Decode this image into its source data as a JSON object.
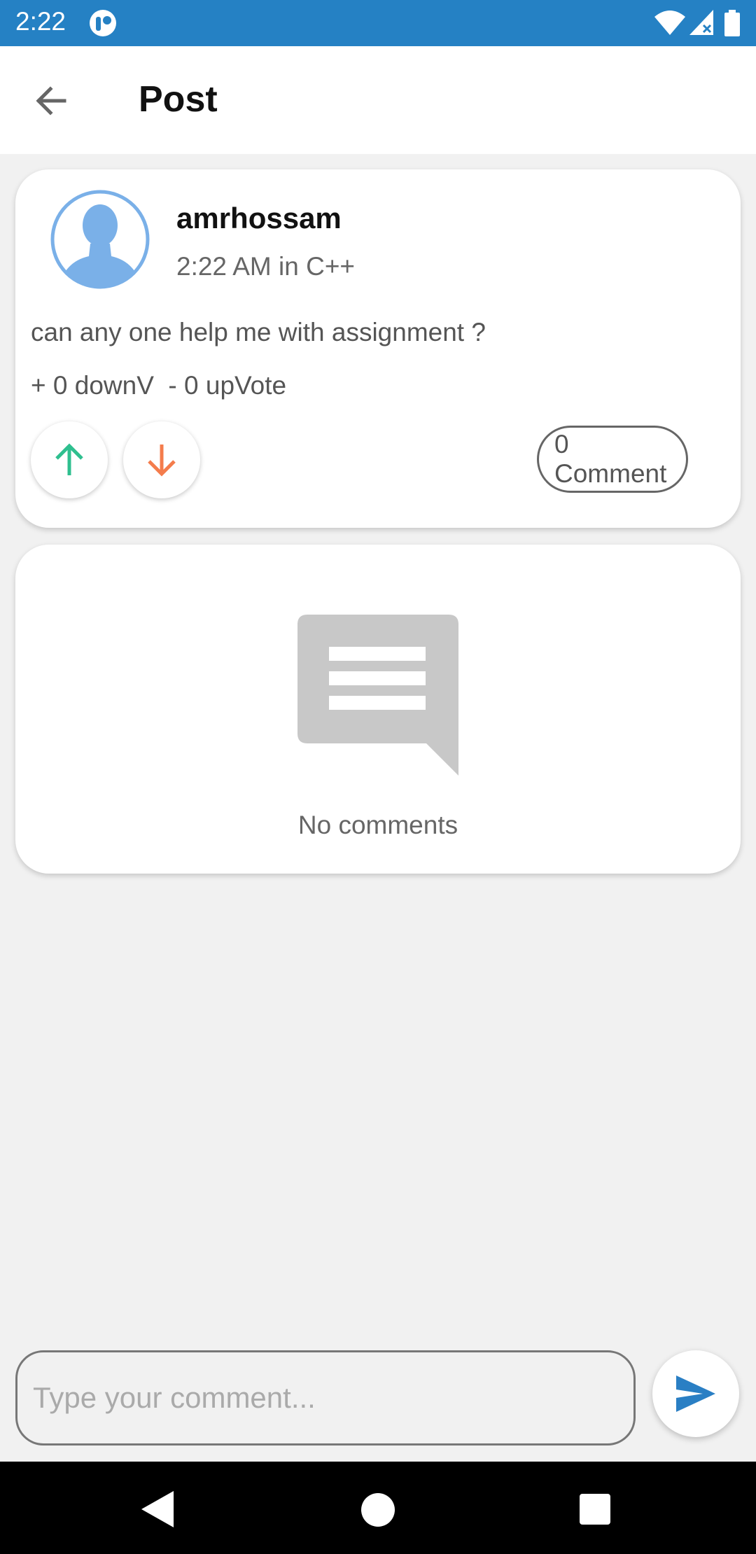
{
  "status_bar": {
    "time": "2:22",
    "icons": [
      "app-notification-icon",
      "wifi-icon",
      "signal-icon",
      "battery-icon"
    ]
  },
  "app_bar": {
    "title": "Post",
    "back_icon": "arrow-left-icon"
  },
  "post": {
    "author": "amrhossam",
    "meta": "2:22 AM in C++",
    "body": "can any one help me with assignment ?",
    "vote_summary": "+ 0 downV  - 0 upVote",
    "comment_button_label": "0 Comment",
    "avatar_icon": "person-avatar-icon",
    "upvote_icon": "arrow-up-icon",
    "downvote_icon": "arrow-down-icon"
  },
  "comments": {
    "empty_text": "No comments",
    "empty_icon": "comment-bubble-icon"
  },
  "composer": {
    "placeholder": "Type your comment...",
    "send_icon": "send-icon"
  },
  "nav_bar": {
    "icons": [
      "nav-back-icon",
      "nav-home-icon",
      "nav-recents-icon"
    ]
  },
  "colors": {
    "status_bar": "#2581c4",
    "background": "#f1f1f1",
    "avatar": "#7ab0e8",
    "upvote": "#2fbf8f",
    "downvote": "#f47c4c",
    "send": "#2a7fc4",
    "empty_icon": "#c8c8c8"
  }
}
